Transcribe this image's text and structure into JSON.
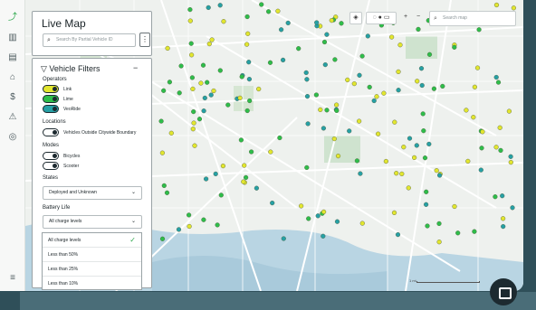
{
  "app": {
    "title": "Live Map",
    "search_placeholder": "Search By Partial Vehicle ID"
  },
  "rail": [
    "chart-icon",
    "map-icon",
    "document-icon",
    "bank-icon",
    "dollar-icon",
    "alert-icon",
    "location-icon",
    "settings-icon"
  ],
  "filters": {
    "title": "Vehicle Filters",
    "operators_label": "Operators",
    "operators": [
      {
        "label": "Link",
        "color": "#e2e62f"
      },
      {
        "label": "Lime",
        "color": "#2ebd4a"
      },
      {
        "label": "VeoRide",
        "color": "#26a0a5"
      }
    ],
    "locations_label": "Locations",
    "locations": [
      {
        "label": "Vehicles Outside Citywide Boundary"
      }
    ],
    "modes_label": "Modes",
    "modes": [
      {
        "label": "Bicycles"
      },
      {
        "label": "Scooter"
      }
    ],
    "states_label": "States",
    "states_value": "Deployed and Unknown",
    "battery_label": "Battery Life",
    "battery_value": "All charge levels",
    "battery_options": [
      "All charge levels",
      "Less than 50%",
      "Less than 25%",
      "Less than 10%"
    ]
  },
  "map": {
    "search_placeholder": "Search map",
    "scale_label": "1 mi",
    "zoom_in": "+",
    "zoom_out": "−"
  }
}
